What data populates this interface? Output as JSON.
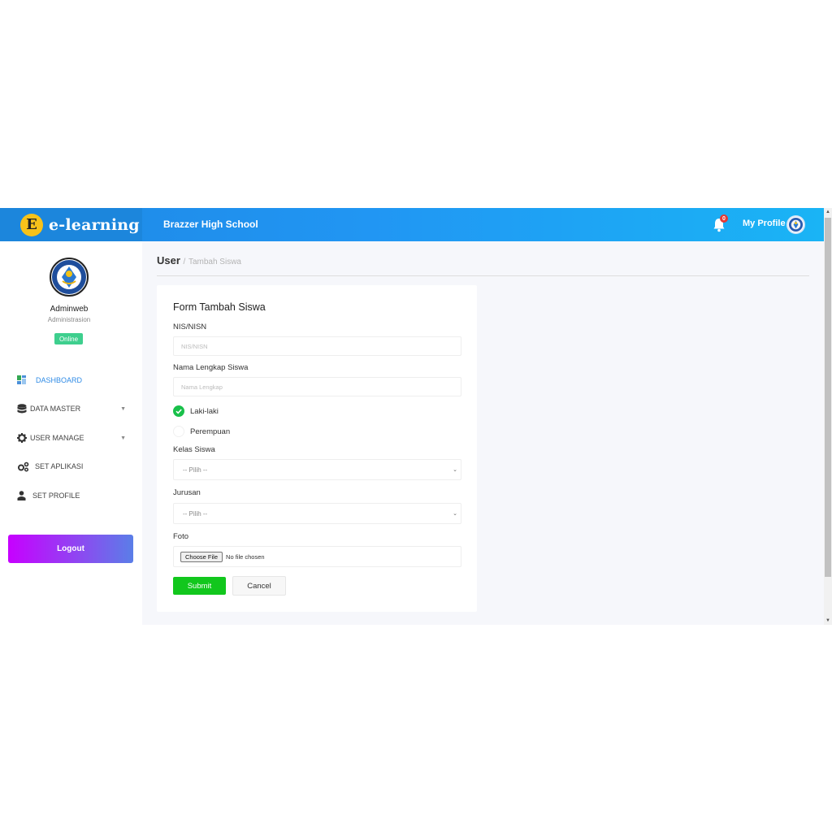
{
  "header": {
    "brand_letter": "E",
    "brand_name": "e-learning",
    "school_name": "Brazzer High School",
    "notification_count": "0",
    "profile_label": "My Profile"
  },
  "sidebar": {
    "user_name": "Adminweb",
    "user_role": "Administrasion",
    "status": "Online",
    "items": [
      {
        "label": "DASHBOARD",
        "icon": "dashboard-icon",
        "active": true
      },
      {
        "label": "DATA MASTER",
        "icon": "database-icon",
        "has_submenu": true
      },
      {
        "label": "USER MANAGE",
        "icon": "gear-icon",
        "has_submenu": true
      },
      {
        "label": "SET APLIKASI",
        "icon": "gears-icon"
      },
      {
        "label": "SET PROFILE",
        "icon": "user-icon"
      }
    ],
    "logout_label": "Logout"
  },
  "breadcrumb": {
    "main": "User",
    "separator": "/",
    "sub": "Tambah Siswa"
  },
  "form": {
    "title": "Form Tambah Siswa",
    "nis_label": "NIS/NISN",
    "nis_placeholder": "NIS/NISN",
    "nama_label": "Nama Lengkap Siswa",
    "nama_placeholder": "Nama Lengkap",
    "gender_options": [
      {
        "label": "Laki-laki",
        "selected": true
      },
      {
        "label": "Perempuan",
        "selected": false
      }
    ],
    "kelas_label": "Kelas Siswa",
    "kelas_selected": "-- Pilih --",
    "jurusan_label": "Jurusan",
    "jurusan_selected": "-- Pilih --",
    "foto_label": "Foto",
    "file_button": "Choose File",
    "file_status": "No file chosen",
    "submit_label": "Submit",
    "cancel_label": "Cancel"
  },
  "colors": {
    "header_start": "#1e88e5",
    "header_end": "#1ab4f5",
    "active_menu": "#2f8be6",
    "online": "#3ecf8e",
    "submit": "#12c71d",
    "radio_checked": "#19c04a",
    "logout_start": "#c700ff",
    "logout_end": "#5a7ee8"
  }
}
